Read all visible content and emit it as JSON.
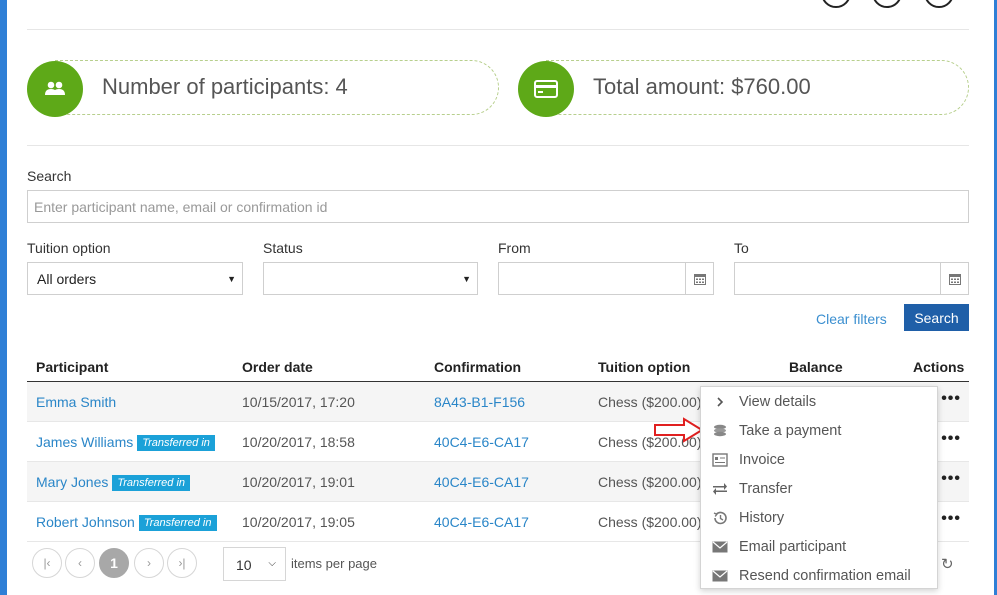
{
  "stats": {
    "participants": "Number of participants: 4",
    "total": "Total amount: $760.00"
  },
  "search": {
    "label": "Search",
    "placeholder": "Enter participant name, email or confirmation id"
  },
  "filters": {
    "tuition_label": "Tuition option",
    "tuition_value": "All orders",
    "status_label": "Status",
    "status_value": "",
    "from_label": "From",
    "to_label": "To",
    "clear_label": "Clear filters",
    "search_button": "Search"
  },
  "table": {
    "headers": {
      "participant": "Participant",
      "order_date": "Order date",
      "confirmation": "Confirmation",
      "tuition": "Tuition option",
      "balance": "Balance",
      "actions": "Actions"
    },
    "rows": [
      {
        "name": "Emma Smith",
        "badge": "",
        "date": "10/15/2017, 17:20",
        "confirmation": "8A43-B1-F156",
        "tuition": "Chess ($200.00)"
      },
      {
        "name": "James Williams",
        "badge": "Transferred in",
        "date": "10/20/2017, 18:58",
        "confirmation": "40C4-E6-CA17",
        "tuition": "Chess ($200.00)"
      },
      {
        "name": "Mary Jones",
        "badge": "Transferred in",
        "date": "10/20/2017, 19:01",
        "confirmation": "40C4-E6-CA17",
        "tuition": "Chess ($200.00)"
      },
      {
        "name": "Robert Johnson",
        "badge": "Transferred in",
        "date": "10/20/2017, 19:05",
        "confirmation": "40C4-E6-CA17",
        "tuition": "Chess ($200.00)"
      }
    ],
    "actions_glyph": "•••"
  },
  "menu": {
    "items": [
      {
        "label": "View details",
        "icon": "chevron-right-icon"
      },
      {
        "label": "Take a payment",
        "icon": "coins-icon"
      },
      {
        "label": "Invoice",
        "icon": "invoice-icon"
      },
      {
        "label": "Transfer",
        "icon": "transfer-icon"
      },
      {
        "label": "History",
        "icon": "history-icon"
      },
      {
        "label": "Email participant",
        "icon": "envelope-icon"
      },
      {
        "label": "Resend confirmation email",
        "icon": "envelope-icon"
      }
    ]
  },
  "pager": {
    "current_page": "1",
    "page_size": "10",
    "per_page_label": "items per page"
  },
  "colors": {
    "accent_green": "#5ea918",
    "link_blue": "#2a86c8",
    "badge_blue": "#1ba1d8",
    "button_blue": "#1f5fa8",
    "frame_blue": "#2f7fd6",
    "arrow_red": "#e02020"
  }
}
